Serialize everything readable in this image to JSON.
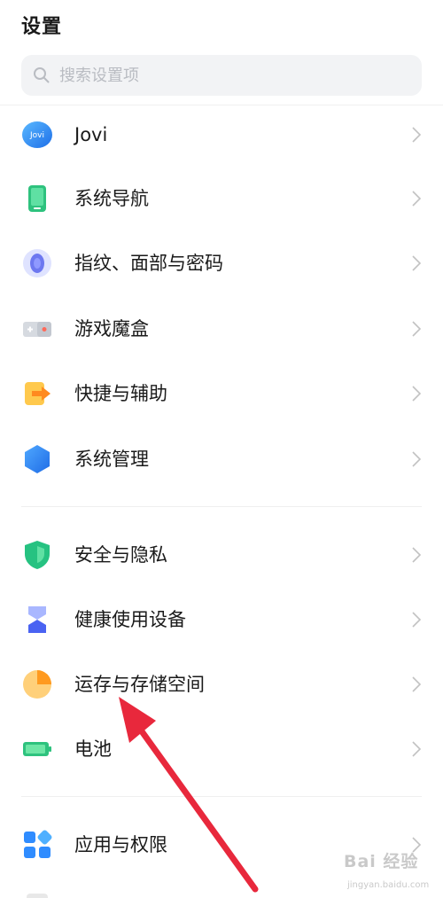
{
  "header": {
    "title": "设置"
  },
  "search": {
    "placeholder": "搜索设置项"
  },
  "items": [
    {
      "label": "Jovi",
      "icon": "jovi-icon"
    },
    {
      "label": "系统导航",
      "icon": "phone-navigation-icon"
    },
    {
      "label": "指纹、面部与密码",
      "icon": "fingerprint-icon"
    },
    {
      "label": "游戏魔盒",
      "icon": "gamepad-icon"
    },
    {
      "label": "快捷与辅助",
      "icon": "shortcut-arrow-icon"
    },
    {
      "label": "系统管理",
      "icon": "hexagon-icon"
    },
    {
      "label": "安全与隐私",
      "icon": "shield-icon"
    },
    {
      "label": "健康使用设备",
      "icon": "hourglass-icon"
    },
    {
      "label": "运存与存储空间",
      "icon": "pie-chart-icon"
    },
    {
      "label": "电池",
      "icon": "battery-icon"
    },
    {
      "label": "应用与权限",
      "icon": "apps-icon"
    }
  ],
  "jovi_icon_text": "Jovi",
  "watermark": {
    "main": "Bai 经验",
    "sub": "jingyan.baidu.com"
  },
  "colors": {
    "annotation_arrow": "#e8283c",
    "chevron": "#c2c2c2",
    "background": "#ffffff"
  }
}
